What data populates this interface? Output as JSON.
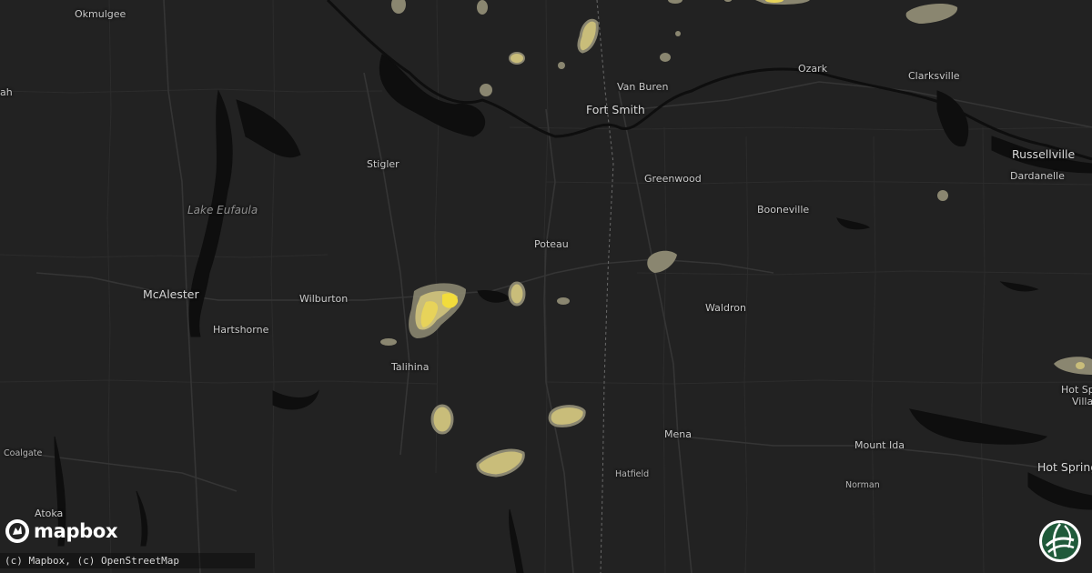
{
  "map": {
    "theme": "dark",
    "background_color": "#222222",
    "water_color": "#0e0e0e",
    "hail_colors": {
      "outer": "#8a8670",
      "mid": "#c9bd7a",
      "inner": "#e7d35a",
      "core": "#f2dc3c"
    }
  },
  "labels": {
    "okmulgee": "Okmulgee",
    "ah": "ah",
    "van_buren": "Van Buren",
    "fort_smith": "Fort Smith",
    "ozark": "Ozark",
    "clarksville": "Clarksville",
    "stigler": "Stigler",
    "lake_eufaula": "Lake Eufaula",
    "greenwood": "Greenwood",
    "russellville": "Russellville",
    "dardanelle": "Dardanelle",
    "booneville": "Booneville",
    "poteau": "Poteau",
    "mcalester": "McAlester",
    "wilburton": "Wilburton",
    "waldron": "Waldron",
    "hartshorne": "Hartshorne",
    "talihina": "Talihina",
    "hot_sp": "Hot Sp",
    "villa": "Villa",
    "mena": "Mena",
    "coalgate": "Coalgate",
    "mount_ida": "Mount Ida",
    "hatfield": "Hatfield",
    "norman": "Norman",
    "hot_spring": "Hot Spring",
    "atoka": "Atoka"
  },
  "branding": {
    "logo_text": "mapbox",
    "logo_icon": "mapbox-logo-icon",
    "attribution": "(c) Mapbox, (c) OpenStreetMap",
    "corner_logo_icon": "hail-globe-logo-icon"
  }
}
